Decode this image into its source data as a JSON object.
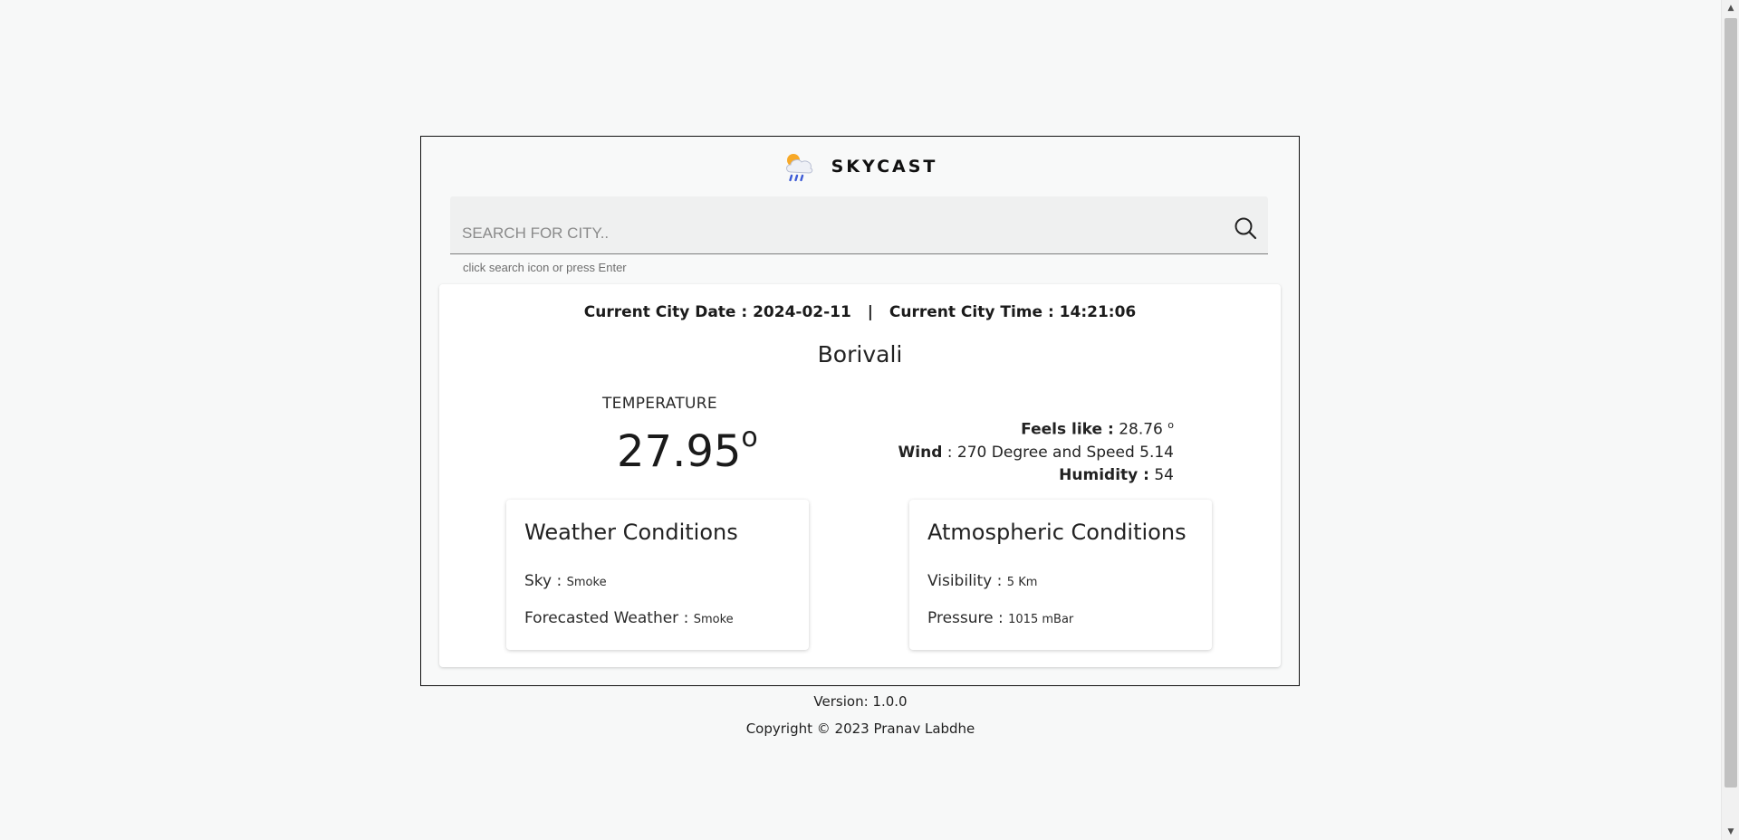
{
  "app": {
    "name": "SKYCAST",
    "logo_icon": "cloud-sun-rain-icon"
  },
  "search": {
    "placeholder": "SEARCH FOR CITY..",
    "value": "",
    "helper_text": "click search icon or press Enter",
    "icon": "search-icon"
  },
  "weather": {
    "date_label": "Current City Date :",
    "date": "2024-02-11",
    "separator": "|",
    "time_label": "Current City Time :",
    "time": "14:21:06",
    "city": "Borivali",
    "temperature_label": "TEMPERATURE",
    "temperature": "27.95",
    "degree_symbol": "o",
    "feels_like_label": "Feels like :",
    "feels_like": "28.76",
    "wind_label": "Wind",
    "wind": ": 270 Degree and Speed 5.14",
    "humidity_label": "Humidity :",
    "humidity": "54"
  },
  "weather_conditions": {
    "title": "Weather Conditions",
    "sky_label": "Sky :",
    "sky": "Smoke",
    "forecast_label": "Forecasted Weather :",
    "forecast": "Smoke"
  },
  "atmospheric_conditions": {
    "title": "Atmospheric Conditions",
    "visibility_label": "Visibility :",
    "visibility": "5 Km",
    "pressure_label": "Pressure :",
    "pressure": "1015 mBar"
  },
  "footer": {
    "version": "Version: 1.0.0",
    "copyright": "Copyright © 2023 Pranav Labdhe"
  },
  "colors": {
    "background": "#f7f8f8",
    "card": "#ffffff",
    "search_bg": "#eff0f0",
    "border": "#111111"
  }
}
